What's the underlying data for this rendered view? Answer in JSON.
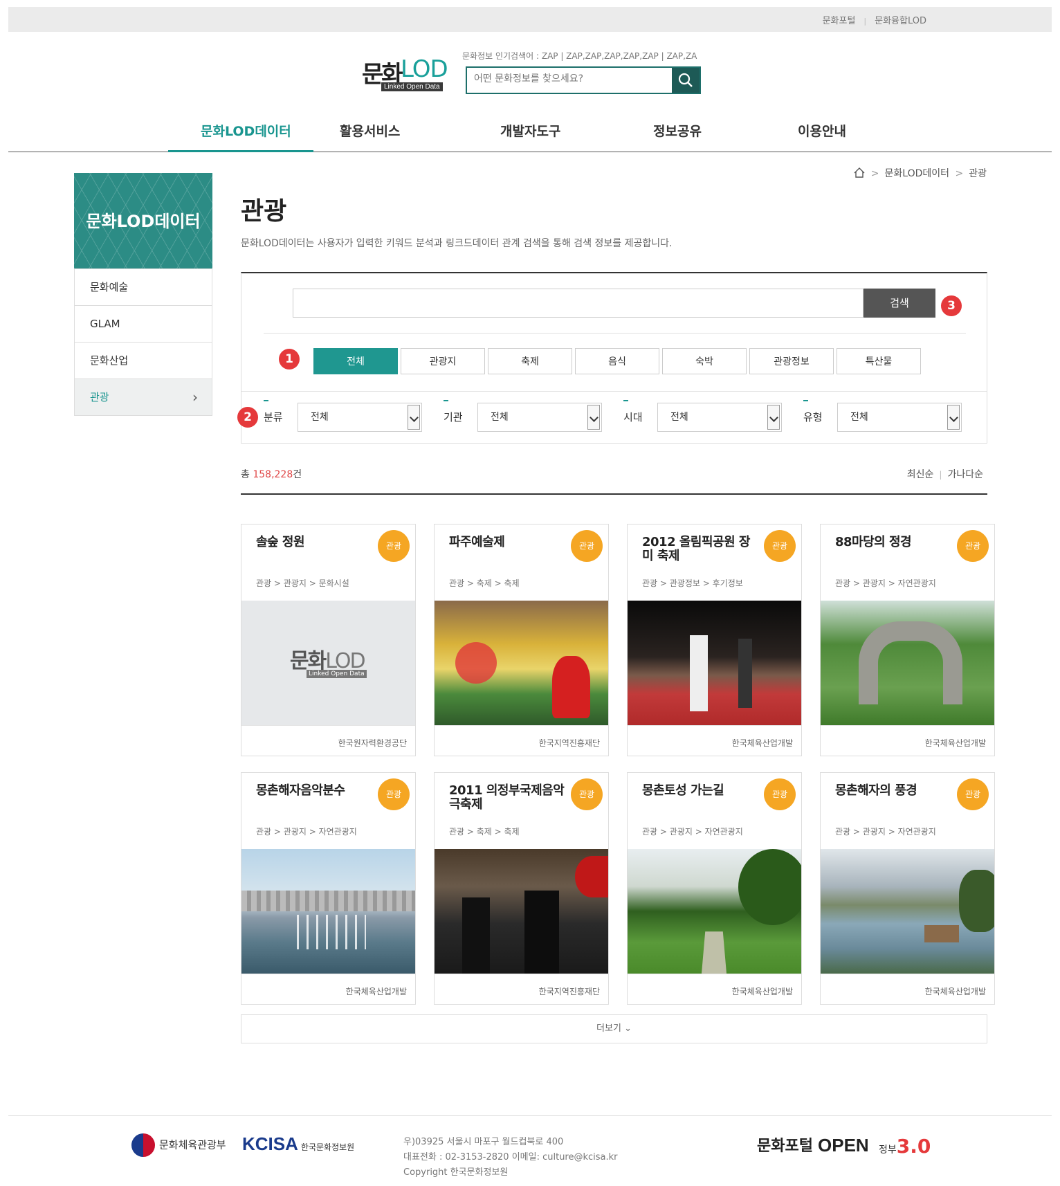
{
  "topbar": {
    "link1": "문화포털",
    "link2": "문화융합LOD"
  },
  "logo": {
    "mun": "문화",
    "lod": "LOD",
    "sub": "Linked Open Data"
  },
  "header": {
    "hot_keywords": "문화정보 인기검색어 : ZAP | ZAP,ZAP,ZAP,ZAP,ZAP | ZAP,ZA",
    "search_placeholder": "어떤 문화정보를 찾으세요?"
  },
  "gnb": [
    "문화LOD데이터",
    "활용서비스",
    "개발자도구",
    "정보공유",
    "이용안내"
  ],
  "sidebar": {
    "title": "문화LOD데이터",
    "items": [
      "문화예술",
      "GLAM",
      "문화산업",
      "관광"
    ]
  },
  "breadcrumb": [
    "문화LOD데이터",
    "관광"
  ],
  "page": {
    "title": "관광",
    "description": "문화LOD데이터는 사용자가 입력한 키워드 분석과 링크드데이터 관계 검색을 통해 검색 정보를 제공합니다."
  },
  "search": {
    "button": "검색",
    "value": ""
  },
  "badges": [
    "1",
    "2",
    "3"
  ],
  "tabs": [
    "전체",
    "관광지",
    "축제",
    "음식",
    "숙박",
    "관광정보",
    "특산물"
  ],
  "filters": [
    {
      "label": "분류",
      "value": "전체"
    },
    {
      "label": "기관",
      "value": "전체"
    },
    {
      "label": "시대",
      "value": "전체"
    },
    {
      "label": "유형",
      "value": "전체"
    }
  ],
  "results": {
    "prefix": "총 ",
    "count": "158,228",
    "suffix": "건"
  },
  "sort": [
    "최신순",
    "가나다순"
  ],
  "cards": [
    {
      "title": "솔숲 정원",
      "tag": "관광",
      "category": "관광 > 관광지 > 문화시설",
      "org": "한국원자력환경공단",
      "image": "placeholder-logo"
    },
    {
      "title": "파주예술제",
      "tag": "관광",
      "category": "관광 > 축제 > 축제",
      "org": "한국지역진흥재단",
      "image": "festival-photo"
    },
    {
      "title": "2012 올림픽공원 장미 축제",
      "tag": "관광",
      "category": "관광 > 관광정보 > 후기정보",
      "org": "한국체육산업개발",
      "image": "night-event-photo"
    },
    {
      "title": "88마당의 정경",
      "tag": "관광",
      "category": "관광 > 관광지 > 자연관광지",
      "org": "한국체육산업개발",
      "image": "stone-sculpture-photo"
    },
    {
      "title": "몽촌해자음악분수",
      "tag": "관광",
      "category": "관광 > 관광지 > 자연관광지",
      "org": "한국체육산업개발",
      "image": "fountain-photo"
    },
    {
      "title": "2011 의정부국제음악극축제",
      "tag": "관광",
      "category": "관광 > 축제 > 축제",
      "org": "한국지역진흥재단",
      "image": "crowd-photo"
    },
    {
      "title": "몽촌토성 가는길",
      "tag": "관광",
      "category": "관광 > 관광지 > 자연관광지",
      "org": "한국체육산업개발",
      "image": "path-photo"
    },
    {
      "title": "몽촌해자의 풍경",
      "tag": "관광",
      "category": "관광 > 관광지 > 자연관광지",
      "org": "한국체육산업개발",
      "image": "lake-photo"
    }
  ],
  "more": "더보기",
  "footer": {
    "ministry": "문화체육관광부",
    "kcisa": "KCISA",
    "kcisa_name": "한국문화정보원",
    "address": "우)03925 서울시 마포구 월드컵북로 400",
    "contact": "대표전화 : 02-3153-2820 이메일: culture@kcisa.kr",
    "copyright": "Copyright 한국문화정보원",
    "portal": "문화포털",
    "open": "OPEN",
    "gov": "정부",
    "gov_ver": "3.0"
  },
  "colors": {
    "accent": "#19958f",
    "tag": "#f5a623",
    "badge": "#e5393b"
  }
}
